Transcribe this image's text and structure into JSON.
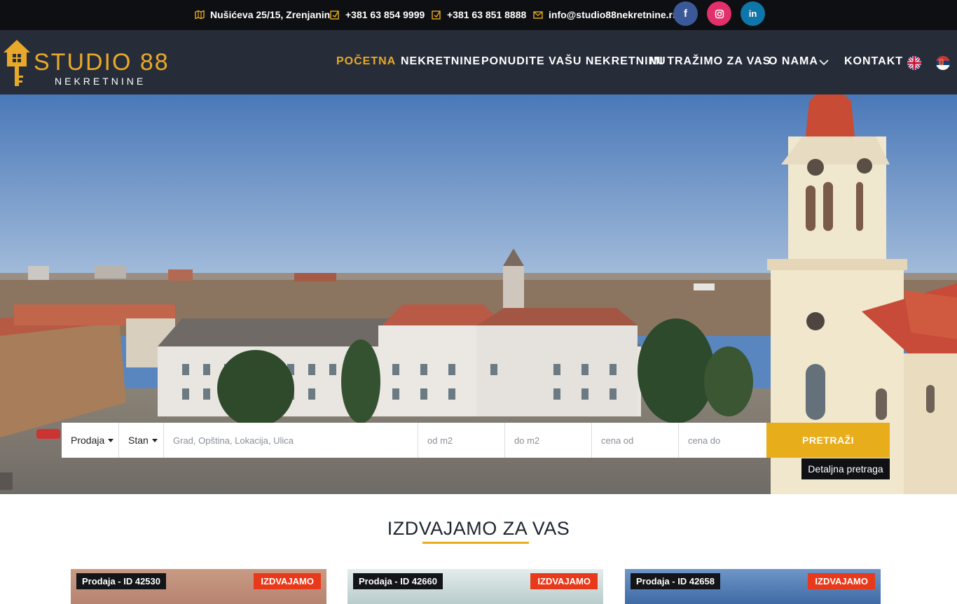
{
  "topbar": {
    "address": "Nušićeva 25/15, Zrenjanin",
    "phone1": "+381 63 854 9999",
    "phone2": "+381 63 851 8888",
    "email": "info@studio88nekretnine.rs",
    "social": [
      {
        "icon": "facebook-icon",
        "glyph": "f",
        "color": "#3b5998"
      },
      {
        "icon": "instagram-icon",
        "glyph": "◎",
        "color": "#e1306c"
      },
      {
        "icon": "linkedin-icon",
        "glyph": "in",
        "color": "#0e76a8"
      }
    ]
  },
  "logo": {
    "title": "STUDIO 88",
    "subtitle": "NEKRETNINE"
  },
  "nav": {
    "items": [
      "POČETNA",
      "NEKRETNINE",
      "PONUDITE VAŠU NEKRETNINU",
      "MI TRAŽIMO ZA VAS",
      "O NAMA",
      "KONTAKT"
    ],
    "active_index": 0
  },
  "search": {
    "type_value": "Prodaja",
    "category_value": "Stan",
    "location_placeholder": "Grad, Opština, Lokacija, Ulica",
    "m2_from_placeholder": "od m2",
    "m2_to_placeholder": "do m2",
    "price_from_placeholder": "cena od",
    "price_to_placeholder": "cena do",
    "button_label": "PRETRAŽI",
    "advanced_label": "Detaljna pretraga"
  },
  "section": {
    "title": "IZDVAJAMO ZA VAS"
  },
  "cards": [
    {
      "tag": "Prodaja - ID 42530",
      "badge": "IZDVAJAMO"
    },
    {
      "tag": "Prodaja - ID 42660",
      "badge": "IZDVAJAMO"
    },
    {
      "tag": "Prodaja - ID 42658",
      "badge": "IZDVAJAMO"
    }
  ],
  "colors": {
    "accent": "#e8ad1a",
    "badge": "#e8391a",
    "header": "#272d38",
    "topbar": "#0d0f12"
  }
}
